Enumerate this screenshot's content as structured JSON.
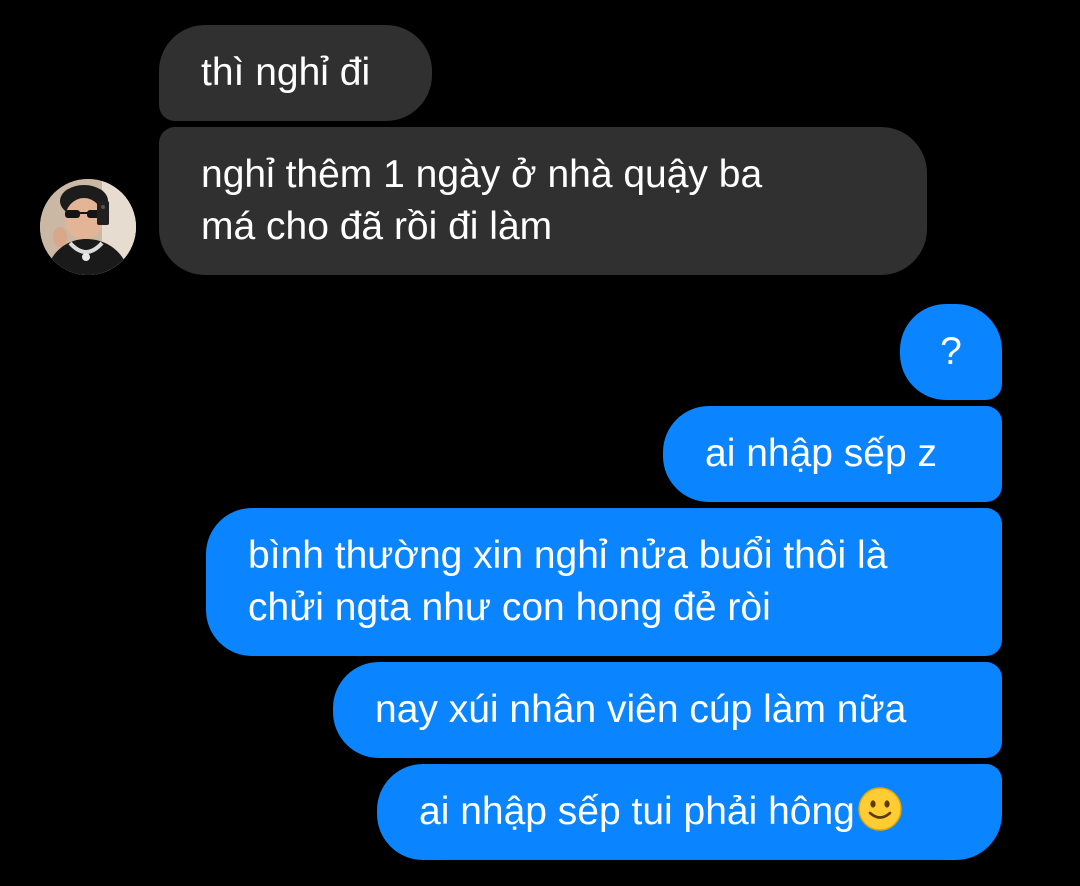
{
  "conversation": {
    "contact": {
      "avatar_icon": "contact-avatar-icon"
    },
    "incoming": [
      {
        "text": "thì nghỉ đi"
      },
      {
        "line1": "nghỉ thêm 1 ngày ở nhà quậy ba",
        "line2": "má cho đã rồi đi làm"
      }
    ],
    "outgoing": [
      {
        "text": "?"
      },
      {
        "text": "ai nhập sếp z"
      },
      {
        "line1": "bình thường xin nghỉ nửa buổi thôi là",
        "line2": "chửi ngta như con hong đẻ ròi"
      },
      {
        "text": "nay xúi nhân viên cúp làm nữa"
      },
      {
        "text": "ai nhập sếp tui phải hông",
        "emoji_icon": "slightly-smiling-face-icon"
      }
    ]
  },
  "colors": {
    "background": "#000000",
    "incoming_bubble": "#303030",
    "outgoing_bubble": "#0a84ff",
    "text": "#ffffff"
  }
}
